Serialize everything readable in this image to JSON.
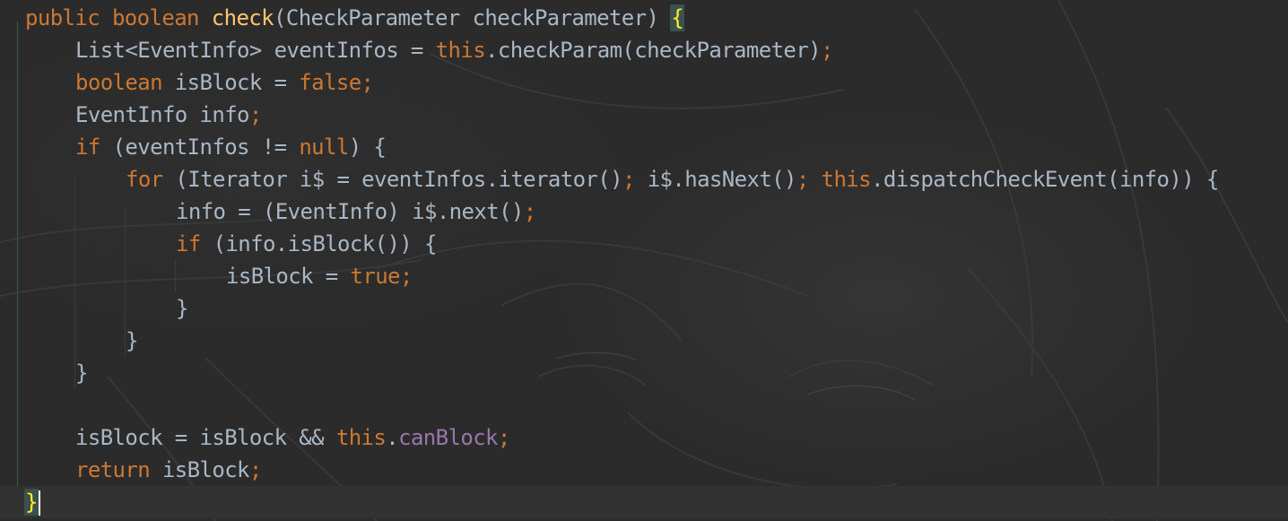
{
  "code": {
    "lines": [
      {
        "indent": 0,
        "tokens": [
          {
            "t": "public ",
            "c": "kw"
          },
          {
            "t": "boolean ",
            "c": "kw"
          },
          {
            "t": "check",
            "c": "fn"
          },
          {
            "t": "(CheckParameter checkParameter) ",
            "c": ""
          },
          {
            "t": "{",
            "c": "brace-match"
          }
        ]
      },
      {
        "indent": 1,
        "tokens": [
          {
            "t": "List<EventInfo> eventInfos = ",
            "c": ""
          },
          {
            "t": "this",
            "c": "kw"
          },
          {
            "t": ".checkParam(checkParameter)",
            "c": ""
          },
          {
            "t": ";",
            "c": "kw"
          }
        ]
      },
      {
        "indent": 1,
        "tokens": [
          {
            "t": "boolean ",
            "c": "kw"
          },
          {
            "t": "isBlock = ",
            "c": ""
          },
          {
            "t": "false",
            "c": "kw"
          },
          {
            "t": ";",
            "c": "kw"
          }
        ]
      },
      {
        "indent": 1,
        "tokens": [
          {
            "t": "EventInfo info",
            "c": ""
          },
          {
            "t": ";",
            "c": "kw"
          }
        ]
      },
      {
        "indent": 1,
        "tokens": [
          {
            "t": "if ",
            "c": "kw"
          },
          {
            "t": "(eventInfos != ",
            "c": ""
          },
          {
            "t": "null",
            "c": "kw"
          },
          {
            "t": ") {",
            "c": ""
          }
        ]
      },
      {
        "indent": 2,
        "tokens": [
          {
            "t": "for ",
            "c": "kw"
          },
          {
            "t": "(Iterator i$ = eventInfos.iterator()",
            "c": ""
          },
          {
            "t": "; ",
            "c": "kw"
          },
          {
            "t": "i$.hasNext()",
            "c": ""
          },
          {
            "t": "; ",
            "c": "kw"
          },
          {
            "t": "this",
            "c": "kw"
          },
          {
            "t": ".dispatchCheckEvent(info)) {",
            "c": ""
          }
        ]
      },
      {
        "indent": 3,
        "tokens": [
          {
            "t": "info = (EventInfo) i$.next()",
            "c": ""
          },
          {
            "t": ";",
            "c": "kw"
          }
        ]
      },
      {
        "indent": 3,
        "tokens": [
          {
            "t": "if ",
            "c": "kw"
          },
          {
            "t": "(info.isBlock()) {",
            "c": ""
          }
        ]
      },
      {
        "indent": 4,
        "tokens": [
          {
            "t": "isBlock = ",
            "c": ""
          },
          {
            "t": "true",
            "c": "kw"
          },
          {
            "t": ";",
            "c": "kw"
          }
        ]
      },
      {
        "indent": 3,
        "tokens": [
          {
            "t": "}",
            "c": ""
          }
        ]
      },
      {
        "indent": 2,
        "tokens": [
          {
            "t": "}",
            "c": ""
          }
        ]
      },
      {
        "indent": 1,
        "tokens": [
          {
            "t": "}",
            "c": ""
          }
        ]
      },
      {
        "indent": 0,
        "tokens": []
      },
      {
        "indent": 1,
        "tokens": [
          {
            "t": "isBlock = isBlock && ",
            "c": ""
          },
          {
            "t": "this",
            "c": "kw"
          },
          {
            "t": ".",
            "c": ""
          },
          {
            "t": "canBlock",
            "c": "field"
          },
          {
            "t": ";",
            "c": "kw"
          }
        ]
      },
      {
        "indent": 1,
        "tokens": [
          {
            "t": "return ",
            "c": "kw"
          },
          {
            "t": "isBlock",
            "c": ""
          },
          {
            "t": ";",
            "c": "kw"
          }
        ]
      },
      {
        "indent": 0,
        "tokens": [
          {
            "t": "}",
            "c": "brace-match"
          }
        ],
        "caret": true
      }
    ]
  },
  "colors": {
    "background": "#2b2b2b",
    "keyword": "#cc7832",
    "method_declaration": "#ffc66d",
    "field": "#9876aa",
    "default_text": "#a9b7c6",
    "matched_brace": "#ffef28",
    "current_line": "#323232"
  }
}
